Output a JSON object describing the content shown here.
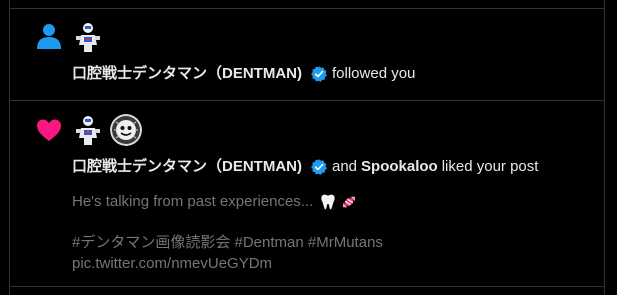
{
  "notifications": [
    {
      "type_icon": "person-icon",
      "actor_name": "口腔戦士デンタマン（DENTMAN)",
      "action_text": "followed you",
      "avatars": [
        "dentman-avatar"
      ]
    },
    {
      "type_icon": "heart-icon",
      "actor_name": "口腔戦士デンタマン（DENTMAN)",
      "connector": "and",
      "second_actor": "Spookaloo",
      "action_text": "liked your post",
      "avatars": [
        "dentman-avatar",
        "spookaloo-avatar"
      ],
      "post": {
        "text": "He's talking from past experiences...",
        "emojis": [
          "tooth-emoji",
          "candy-emoji"
        ],
        "hashtags": "#デンタマン画像読影会 #Dentman #MrMutans",
        "link": "pic.twitter.com/nmevUeGYDm"
      }
    }
  ],
  "colors": {
    "background": "#000000",
    "divider": "#2f3336",
    "text": "#e7e9ea",
    "muted": "#71767b",
    "follow_icon": "#1d9bf0",
    "like_icon": "#f91880",
    "verified": "#1d9bf0"
  }
}
